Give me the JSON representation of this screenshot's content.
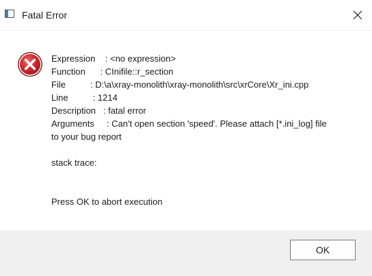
{
  "window": {
    "title": "Fatal Error"
  },
  "icons": {
    "app": "window-app-icon",
    "close": "close-icon",
    "error": "error-icon"
  },
  "colors": {
    "error_red": "#d0282f",
    "footer_bg": "#f0f0f0"
  },
  "message": {
    "expression": "Expression    : <no expression>",
    "function": "Function      : CInifile::r_section",
    "file": "File          : D:\\a\\xray-monolith\\xray-monolith\\src\\xrCore\\Xr_ini.cpp",
    "line": "Line          : 1214",
    "description": "Description   : fatal error",
    "arguments_1": "Arguments     : Can't open section 'speed'. Please attach [*.ini_log] file",
    "arguments_2": "to your bug report",
    "stack_trace": "stack trace:",
    "abort_notice": "Press OK to abort execution"
  },
  "buttons": {
    "ok_label": "OK"
  }
}
